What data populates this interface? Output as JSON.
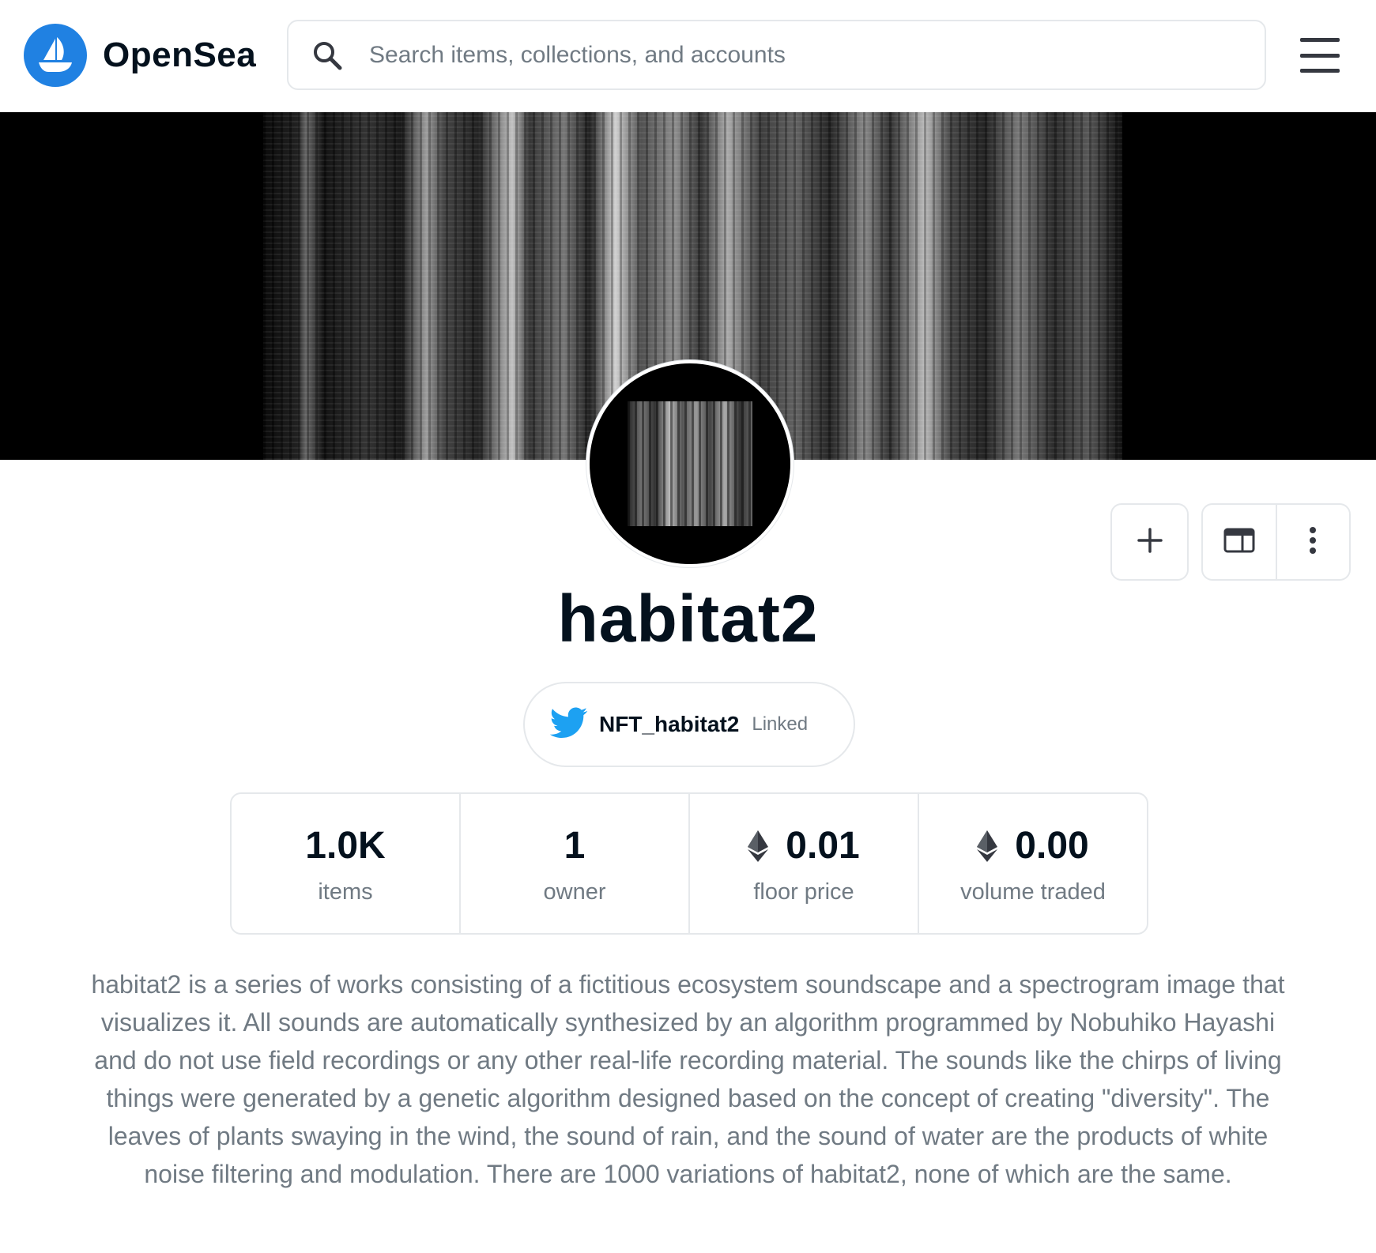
{
  "header": {
    "logo_text": "OpenSea",
    "search_placeholder": "Search items, collections, and accounts",
    "icons": {
      "logo": "opensea-ship-icon",
      "search": "search-icon",
      "menu": "hamburger-menu-icon"
    }
  },
  "collection": {
    "title": "habitat2",
    "twitter": {
      "handle": "NFT_habitat2",
      "status": "Linked",
      "icon": "twitter-bird-icon"
    },
    "actions": [
      {
        "name": "add",
        "icon": "plus-icon"
      },
      {
        "name": "website",
        "icon": "browser-window-icon"
      },
      {
        "name": "more",
        "icon": "more-vertical-icon"
      }
    ]
  },
  "stats": [
    {
      "value": "1.0K",
      "label": "items",
      "currency_icon": false
    },
    {
      "value": "1",
      "label": "owner",
      "currency_icon": false
    },
    {
      "value": "0.01",
      "label": "floor price",
      "currency_icon": true
    },
    {
      "value": "0.00",
      "label": "volume traded",
      "currency_icon": true
    }
  ],
  "description": "habitat2 is a series of works consisting of a fictitious ecosystem soundscape and a spectrogram image that visualizes it. All sounds are automatically synthesized by an algorithm programmed by Nobuhiko Hayashi and do not use field recordings or any other real-life recording material. The sounds like the chirps of living things were generated by a genetic algorithm designed based on the concept of creating \"diversity\". The leaves of plants swaying in the wind, the sound of rain, and the sound of water are the products of white noise filtering and modulation. There are 1000 variations of habitat2, none of which are the same.",
  "colors": {
    "brand": "#2081e2",
    "twitter": "#1da1f2",
    "text_primary": "#04111d",
    "text_secondary": "#707a83",
    "border": "#e5e8eb"
  }
}
